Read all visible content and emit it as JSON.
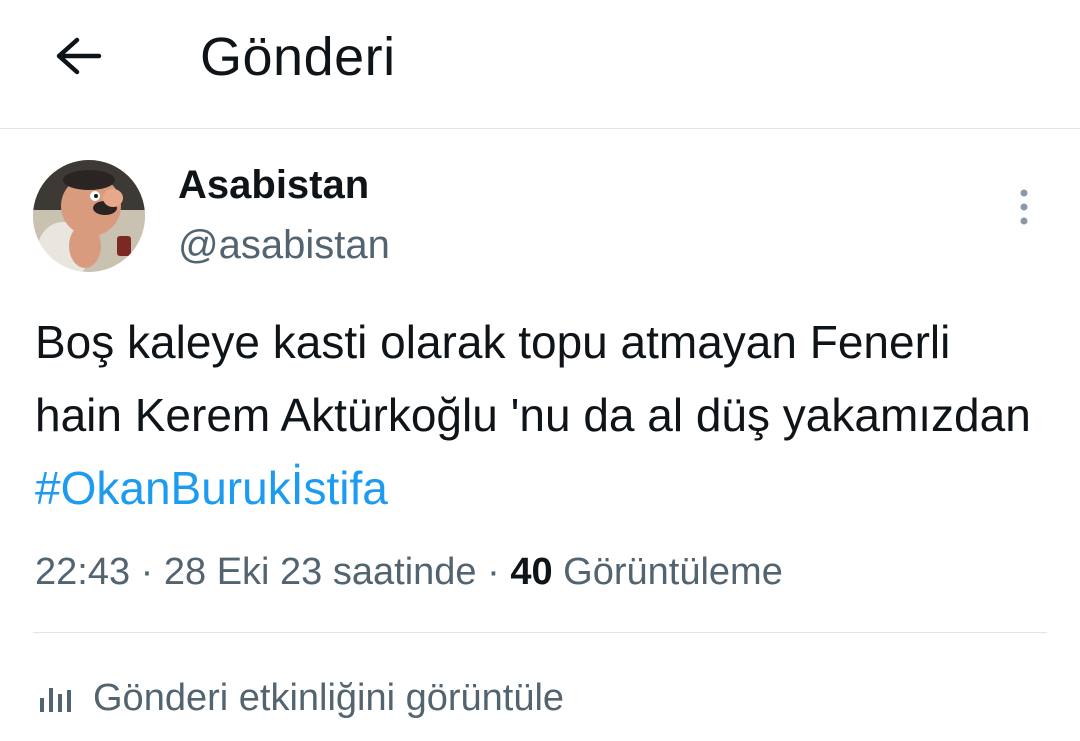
{
  "header": {
    "title": "Gönderi",
    "back_icon": "arrow-left-icon"
  },
  "author": {
    "display_name": "Asabistan",
    "handle": "@asabistan",
    "avatar": "avatar-cartoon-man"
  },
  "tweet": {
    "text": "Boş kaleye kasti olarak topu atmayan Fenerli hain Kerem Aktürkoğlu 'nu da al düş yakamızdan ",
    "hashtag": "#OkanBurukİstifa"
  },
  "meta": {
    "time": "22:43",
    "separator": "·",
    "date": "28 Eki 23 saatinde",
    "views_count": "40",
    "views_label": "Görüntüleme"
  },
  "activity": {
    "label": "Gönderi etkinliğini görüntüle",
    "icon": "bar-chart-icon"
  },
  "more_icon": "vertical-ellipsis-icon",
  "colors": {
    "hashtag": "#1d9bf0",
    "secondary_text": "#536471",
    "primary_text": "#0f1419",
    "divider": "#e1e6ea"
  }
}
